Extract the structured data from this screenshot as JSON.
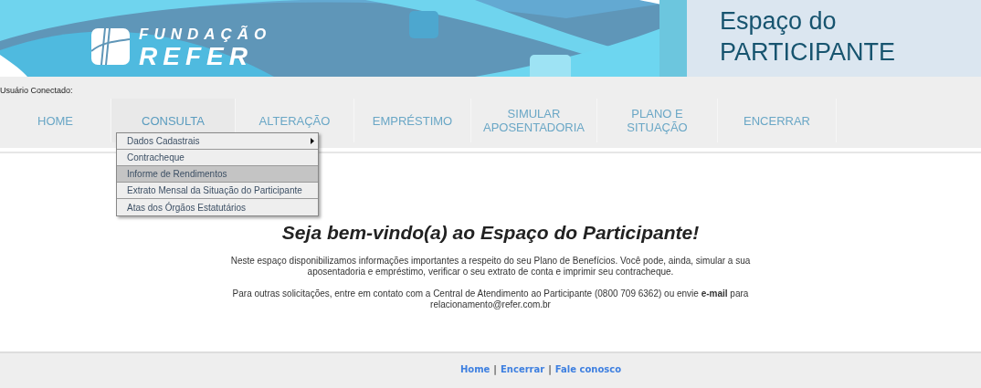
{
  "banner": {
    "logo_top": "FUNDAÇÃO",
    "logo_bottom": "REFER",
    "title_line1": "Espaço do",
    "title_line2": "PARTICIPANTE"
  },
  "user_label": "Usuário Conectado:",
  "nav": [
    {
      "label": "HOME",
      "selected": false
    },
    {
      "label": "CONSULTA",
      "selected": true
    },
    {
      "label": "ALTERAÇÃO",
      "selected": false
    },
    {
      "label": "EMPRÉSTIMO",
      "selected": false
    },
    {
      "label": "SIMULAR APOSENTADORIA",
      "selected": false
    },
    {
      "label": "PLANO E SITUAÇÃO",
      "selected": false
    },
    {
      "label": "ENCERRAR",
      "selected": false
    }
  ],
  "dropdown": [
    {
      "label": "Dados Cadastrais",
      "has_submenu": true,
      "highlighted": false
    },
    {
      "label": "Contracheque",
      "has_submenu": false,
      "highlighted": false
    },
    {
      "label": "Informe de Rendimentos",
      "has_submenu": false,
      "highlighted": true
    },
    {
      "label": "Extrato Mensal da Situação do Participante",
      "has_submenu": false,
      "highlighted": false
    },
    {
      "label": "Atas dos Órgãos Estatutários",
      "has_submenu": false,
      "highlighted": false
    }
  ],
  "welcome": {
    "heading": "Seja bem-vindo(a) ao Espaço do Participante!",
    "paragraphs": [
      "Neste espaço disponibilizamos informações importantes a respeito do seu Plano de Benefícios. Você pode, ainda, simular a sua aposentadoria e empréstimo, verificar o seu extrato de conta e imprimir seu contracheque.",
      "Para outras solicitações, entre em contato com a Central de Atendimento ao Participante (0800 709 6362) ou envie **e-mail** para relacionamento@refer.com.br"
    ]
  },
  "footer": [
    {
      "kind": "link",
      "text": "Home"
    },
    {
      "kind": "separator",
      "text": "|"
    },
    {
      "kind": "link",
      "text": "Encerrar"
    },
    {
      "kind": "separator",
      "text": "|"
    },
    {
      "kind": "link",
      "text": "Fale conosco"
    }
  ]
}
